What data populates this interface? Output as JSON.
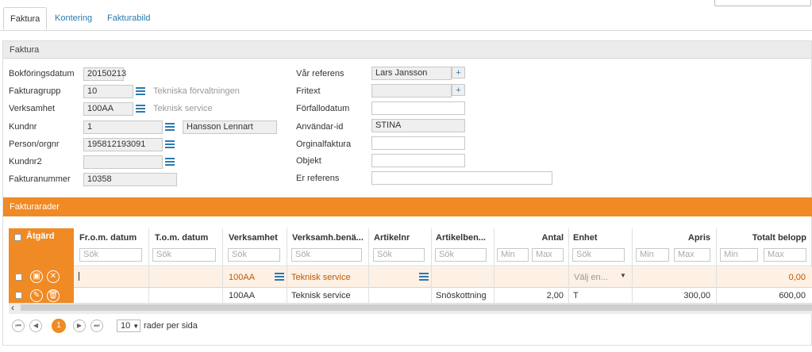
{
  "tabs": [
    {
      "label": "Faktura"
    },
    {
      "label": "Kontering"
    },
    {
      "label": "Fakturabild"
    }
  ],
  "panel": {
    "title": "Faktura"
  },
  "left_fields": {
    "bokforingsdatum": {
      "label": "Bokföringsdatum",
      "value": "20150213"
    },
    "fakturagrupp": {
      "label": "Fakturagrupp",
      "value": "10",
      "hint": "Tekniska förvaltningen"
    },
    "verksamhet": {
      "label": "Verksamhet",
      "value": "100AA",
      "hint": "Teknisk service"
    },
    "kundnr": {
      "label": "Kundnr",
      "value": "1",
      "name": "Hansson Lennart"
    },
    "personorgnr": {
      "label": "Person/orgnr",
      "value": "195812193091"
    },
    "kundnr2": {
      "label": "Kundnr2",
      "value": ""
    },
    "fakturanummer": {
      "label": "Fakturanummer",
      "value": "10358"
    }
  },
  "right_fields": {
    "var_referens": {
      "label": "Vår referens",
      "value": "Lars Jansson"
    },
    "fritext": {
      "label": "Fritext",
      "value": ""
    },
    "forfallodatum": {
      "label": "Förfallodatum",
      "value": ""
    },
    "anvandar_id": {
      "label": "Användar-id",
      "value": "STINA"
    },
    "orginalfaktura": {
      "label": "Orginalfaktura",
      "value": ""
    },
    "objekt": {
      "label": "Objekt",
      "value": ""
    },
    "er_referens": {
      "label": "Er referens",
      "value": ""
    }
  },
  "rows_section": {
    "title": "Fakturarader"
  },
  "table": {
    "columns": {
      "atgard": "Åtgärd",
      "from": "Fr.o.m. datum",
      "tom": "T.o.m. datum",
      "verksamhet": "Verksamhet",
      "verksamh_ben": "Verksamh.benä...",
      "artikelnr": "Artikelnr",
      "artikelben": "Artikelben...",
      "antal": "Antal",
      "enhet": "Enhet",
      "apris": "Apris",
      "totalt": "Totalt belopp"
    },
    "search_placeholder": "Sök",
    "min_placeholder": "Min",
    "max_placeholder": "Max",
    "edit_row": {
      "verksamhet": "100AA",
      "verksamh_ben": "Teknisk service",
      "enhet_placeholder": "Välj en...",
      "totalt": "0,00"
    },
    "rows": [
      {
        "verksamhet": "100AA",
        "verksamh_ben": "Teknisk service",
        "artikelben": "Snöskottning",
        "antal": "2,00",
        "enhet": "T",
        "apris": "300,00",
        "totalt": "600,00"
      }
    ]
  },
  "pager": {
    "current_page": "1",
    "page_size": "10",
    "per_page_label": "rader per sida"
  }
}
